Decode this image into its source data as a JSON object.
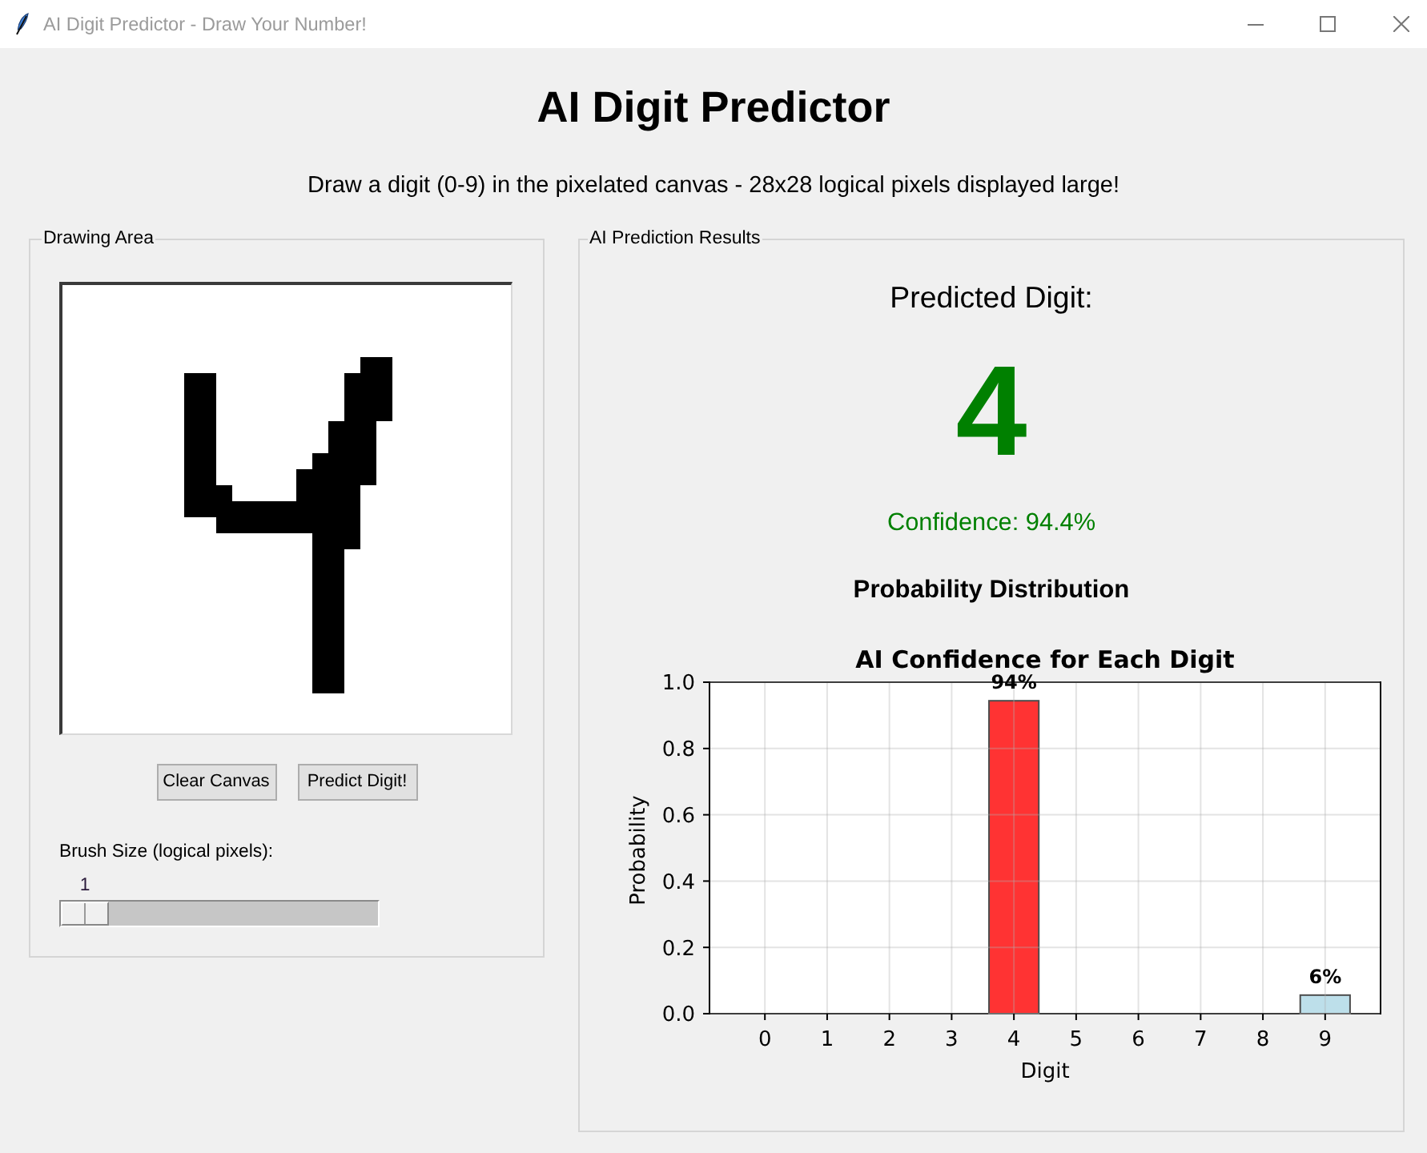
{
  "window": {
    "title": "AI Digit Predictor - Draw Your Number!"
  },
  "header": {
    "title": "AI Digit Predictor",
    "subtitle": "Draw a digit (0-9) in the pixelated canvas - 28x28 logical pixels displayed large!"
  },
  "drawing_area": {
    "title": "Drawing Area",
    "buttons": [
      "Clear Canvas",
      "Predict Digit!"
    ],
    "brush_size": {
      "label": "Brush Size (logical pixels):",
      "value": "1",
      "level": 0
    }
  },
  "results": {
    "title": "AI Prediction Results",
    "predicted_label": "Predicted Digit:",
    "predicted_digit": "4",
    "confidence": "Confidence: 94.4%",
    "distribution_title": "Probability Distribution",
    "chart_data": {
      "type": "bar",
      "title": "AI Confidence for Each Digit",
      "xlabel": "Digit",
      "ylabel": "Probability",
      "categories": [
        "0",
        "1",
        "2",
        "3",
        "4",
        "5",
        "6",
        "7",
        "8",
        "9"
      ],
      "series": [
        {
          "color": "#ff3333",
          "values": [
            0,
            0,
            0,
            0,
            0.944,
            0,
            0,
            0,
            0,
            0
          ]
        },
        {
          "color": "#bddfea",
          "values": [
            0,
            0,
            0,
            0,
            0,
            0,
            0,
            0,
            0,
            0.056
          ]
        }
      ],
      "stacked": true,
      "grid": true,
      "ylim": [
        0,
        1
      ],
      "yticks": [
        {
          "value": 0,
          "label": "0.0"
        },
        {
          "value": 0.2,
          "label": "0.2"
        },
        {
          "value": 0.4,
          "label": "0.4"
        },
        {
          "value": 0.6,
          "label": "0.6"
        },
        {
          "value": 0.8,
          "label": "0.8"
        },
        {
          "value": 1,
          "label": "1.0"
        }
      ],
      "value_labels": [
        null,
        null,
        null,
        null,
        "94%",
        null,
        null,
        null,
        null,
        "6%"
      ]
    }
  }
}
